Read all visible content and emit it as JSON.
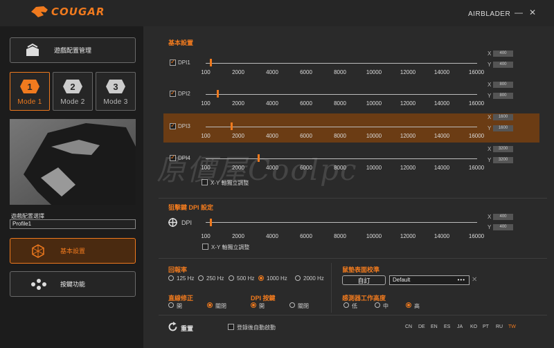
{
  "titlebar": {
    "brand": "COUGAR",
    "app_name": "AIRBLADER",
    "minimize": "—",
    "close": "✕"
  },
  "sidebar": {
    "game_profile_btn": "遊戲配置管理",
    "modes": [
      {
        "num": "1",
        "label": "Mode 1"
      },
      {
        "num": "2",
        "label": "Mode 2"
      },
      {
        "num": "3",
        "label": "Mode 3"
      }
    ],
    "profile_select_label": "遊戲配置選擇",
    "profile_value": "Profile1",
    "basic_settings_btn": "基本設置",
    "key_function_btn": "按鍵功能"
  },
  "basic": {
    "title": "基本設置",
    "ticks": [
      "100",
      "2000",
      "4000",
      "6000",
      "8000",
      "10000",
      "12000",
      "14000",
      "16000"
    ],
    "x_label": "X",
    "y_label": "Y",
    "rows": [
      {
        "label": "DPI1",
        "x": "400",
        "y": "400",
        "value": 400
      },
      {
        "label": "DPI2",
        "x": "800",
        "y": "800",
        "value": 800
      },
      {
        "label": "DPI3",
        "x": "1600",
        "y": "1600",
        "value": 1600
      },
      {
        "label": "DPI4",
        "x": "3200",
        "y": "3200",
        "value": 3200
      }
    ],
    "xy_independent": "X-Y 軸獨立調整"
  },
  "sniper": {
    "title": "狙擊鍵 DPI 設定",
    "dpi_label": "DPI",
    "x": "400",
    "y": "400",
    "value": 400,
    "xy_independent": "X-Y 軸獨立調整"
  },
  "polling": {
    "title": "回報率",
    "options": [
      "125 Hz",
      "250 Hz",
      "500 Hz",
      "1000 Hz",
      "2000 Hz"
    ],
    "selected": 3
  },
  "surface": {
    "title": "鼠墊表面校準",
    "custom_btn": "自訂",
    "value": "Default",
    "more": "•••",
    "clear": "✕"
  },
  "angle_snap": {
    "title": "直線修正",
    "options": [
      "開",
      "關閉"
    ],
    "selected": 1
  },
  "dpi_button": {
    "title": "DPI 按鍵",
    "options": [
      "開",
      "關閉"
    ],
    "selected": 0
  },
  "lod": {
    "title": "感測器工作高度",
    "options": [
      "低",
      "中",
      "高"
    ],
    "selected": 2
  },
  "footer": {
    "reset": "重置",
    "autostart": "登錄後自動啟動",
    "languages": [
      "CN",
      "DE",
      "EN",
      "ES",
      "JA",
      "KO",
      "PT",
      "RU",
      "TW"
    ],
    "active_lang": "TW"
  },
  "watermark": "原價屋Coolpc",
  "colors": {
    "accent": "#f07a1e",
    "highlight": "#6b3c14"
  }
}
